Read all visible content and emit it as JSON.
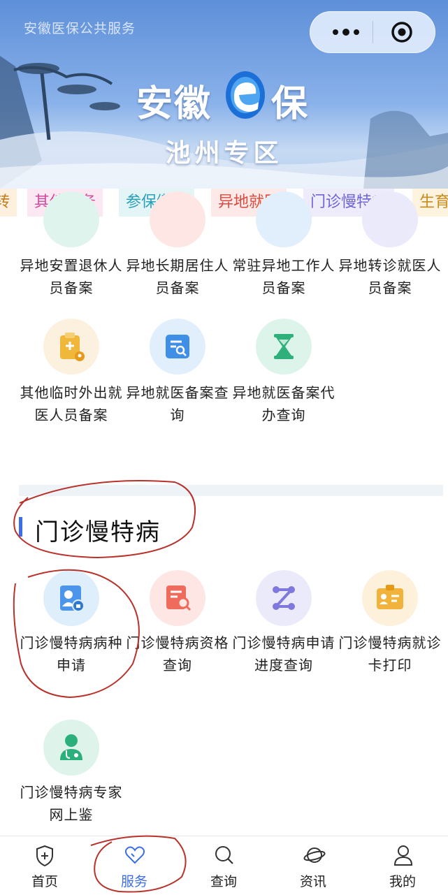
{
  "header": {
    "mini_title": "安徽医保公共服务",
    "brand_left": "安徽",
    "brand_right": "保",
    "zone": "池州专区"
  },
  "tabs": [
    {
      "label": "转",
      "color": "#c47a1a",
      "bg": "#fdf0df"
    },
    {
      "label": "其他业务",
      "color": "#d0489b",
      "bg": "#fce8f3"
    },
    {
      "label": "参保缴费",
      "color": "#2a9fb8",
      "bg": "#e4f5f8"
    },
    {
      "label": "异地就医",
      "color": "#d94b3f",
      "bg": "#fde9e7"
    },
    {
      "label": "门诊慢特病",
      "color": "#6e64d4",
      "bg": "#eeecfb"
    },
    {
      "label": "生育",
      "color": "#c98a1e",
      "bg": "#fdf3df"
    }
  ],
  "remote_items": [
    {
      "label": "异地安置退休人员备案"
    },
    {
      "label": "异地长期居住人员备案"
    },
    {
      "label": "常驻异地工作人员备案"
    },
    {
      "label": "异地转诊就医人员备案"
    },
    {
      "label": "其他临时外出就医人员备案",
      "icon": "clipboard-plus-icon",
      "bg": "#fbf1de",
      "fg": "#f0b73a"
    },
    {
      "label": "异地就医备案查询",
      "icon": "document-search-icon",
      "bg": "#e1eefb",
      "fg": "#3f8fe6"
    },
    {
      "label": "异地就医备案代办查询",
      "icon": "hourglass-icon",
      "bg": "#ddf4ea",
      "fg": "#2fb07a"
    }
  ],
  "chronic_section": {
    "title": "门诊慢特病",
    "items": [
      {
        "label": "门诊慢特病病种申请",
        "icon": "person-card-icon",
        "bg": "#dfeefb",
        "fg": "#4b95ea"
      },
      {
        "label": "门诊慢特病资格查询",
        "icon": "document-search-icon",
        "bg": "#fde6e4",
        "fg": "#ef6b5c"
      },
      {
        "label": "门诊慢特病申请进度查询",
        "icon": "progress-nodes-icon",
        "bg": "#ebeafb",
        "fg": "#7f78dd"
      },
      {
        "label": "门诊慢特病就诊卡打印",
        "icon": "id-card-icon",
        "bg": "#fdf1dc",
        "fg": "#f2b33c"
      },
      {
        "label": "门诊慢特病专家网上鉴",
        "icon": "doctor-icon",
        "bg": "#def3e9",
        "fg": "#2bb07c"
      }
    ]
  },
  "bottom_nav": [
    {
      "label": "首页",
      "icon": "shield-plus-icon"
    },
    {
      "label": "服务",
      "icon": "heart-icon",
      "active": true
    },
    {
      "label": "查询",
      "icon": "search-icon"
    },
    {
      "label": "资讯",
      "icon": "planet-icon"
    },
    {
      "label": "我的",
      "icon": "user-icon"
    }
  ],
  "colors": {
    "accent": "#3d6ee8",
    "annotation": "#c0392b"
  }
}
